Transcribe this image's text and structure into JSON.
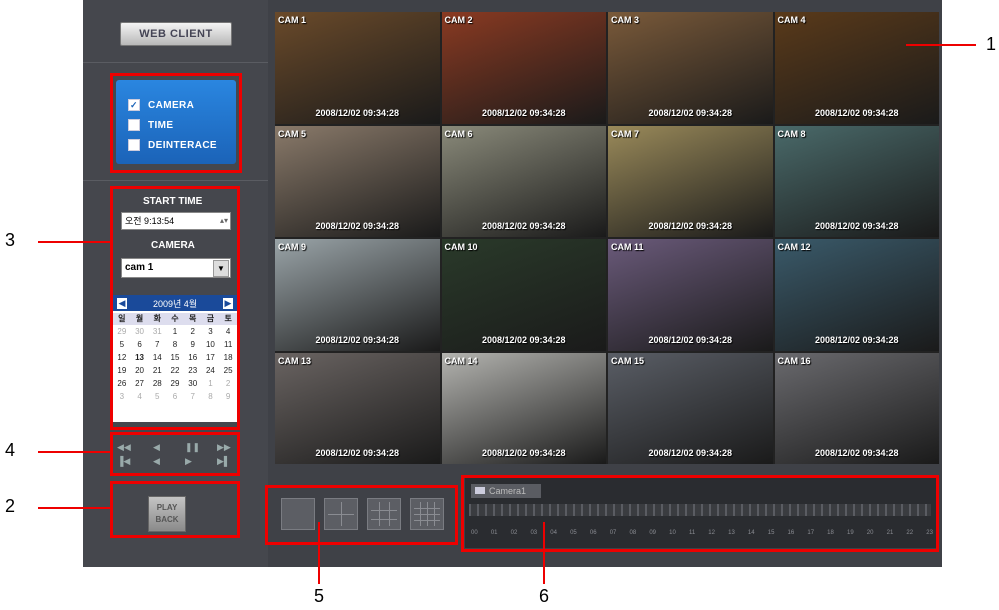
{
  "header": {
    "title": "WEB CLIENT"
  },
  "options": [
    {
      "label": "CAMERA",
      "checked": true
    },
    {
      "label": "TIME",
      "checked": false
    },
    {
      "label": "DEINTERACE",
      "checked": false
    }
  ],
  "search": {
    "start_time_label": "START TIME",
    "time_value": "오전 9:13:54",
    "camera_label": "CAMERA",
    "camera_selected": "cam 1"
  },
  "calendar": {
    "month": "2009년 4월",
    "weekdays": [
      "일",
      "월",
      "화",
      "수",
      "목",
      "금",
      "토"
    ],
    "days": [
      "29",
      "30",
      "31",
      "1",
      "2",
      "3",
      "4",
      "5",
      "6",
      "7",
      "8",
      "9",
      "10",
      "11",
      "12",
      "13",
      "14",
      "15",
      "16",
      "17",
      "18",
      "19",
      "20",
      "21",
      "22",
      "23",
      "24",
      "25",
      "26",
      "27",
      "28",
      "29",
      "30",
      "1",
      "2",
      "3",
      "4",
      "5",
      "6",
      "7",
      "8",
      "9"
    ]
  },
  "playback": {
    "label_line1": "PLAY",
    "label_line2": "BACK"
  },
  "cameras": [
    {
      "name": "CAM 1",
      "timestamp": "2008/12/02  09:34:28",
      "color": "#6a4a2a"
    },
    {
      "name": "CAM 2",
      "timestamp": "2008/12/02  09:34:28",
      "color": "#8a3a22"
    },
    {
      "name": "CAM 3",
      "timestamp": "2008/12/02  09:34:28",
      "color": "#7a5a3a"
    },
    {
      "name": "CAM 4",
      "timestamp": "2008/12/02  09:34:28",
      "color": "#5a3a1a"
    },
    {
      "name": "CAM 5",
      "timestamp": "2008/12/02  09:34:28",
      "color": "#8a7a6a"
    },
    {
      "name": "CAM 6",
      "timestamp": "2008/12/02  09:34:28",
      "color": "#8a8a7a"
    },
    {
      "name": "CAM 7",
      "timestamp": "2008/12/02  09:34:28",
      "color": "#9a8a5a"
    },
    {
      "name": "CAM 8",
      "timestamp": "2008/12/02  09:34:28",
      "color": "#4a6a6a"
    },
    {
      "name": "CAM 9",
      "timestamp": "2008/12/02  09:34:28",
      "color": "#9aa4a8"
    },
    {
      "name": "CAM 10",
      "timestamp": "2008/12/02  09:34:28",
      "color": "#2a3a2a"
    },
    {
      "name": "CAM 11",
      "timestamp": "2008/12/02  09:34:28",
      "color": "#6a5a7a"
    },
    {
      "name": "CAM 12",
      "timestamp": "2008/12/02  09:34:28",
      "color": "#3a5a6a"
    },
    {
      "name": "CAM 13",
      "timestamp": "2008/12/02  09:34:28",
      "color": "#6a6462"
    },
    {
      "name": "CAM 14",
      "timestamp": "2008/12/02  09:34:28",
      "color": "#b4b4b0"
    },
    {
      "name": "CAM 15",
      "timestamp": "2008/12/02  09:34:28",
      "color": "#5a5e66"
    },
    {
      "name": "CAM 16",
      "timestamp": "2008/12/02  09:34:28",
      "color": "#6a6a6e"
    }
  ],
  "timeline": {
    "tab_label": "Camera1",
    "hours": [
      "00",
      "01",
      "02",
      "03",
      "04",
      "05",
      "06",
      "07",
      "08",
      "09",
      "10",
      "11",
      "12",
      "13",
      "14",
      "15",
      "16",
      "17",
      "18",
      "19",
      "20",
      "21",
      "22",
      "23"
    ]
  },
  "callouts": [
    "1",
    "2",
    "3",
    "4",
    "5",
    "6"
  ]
}
